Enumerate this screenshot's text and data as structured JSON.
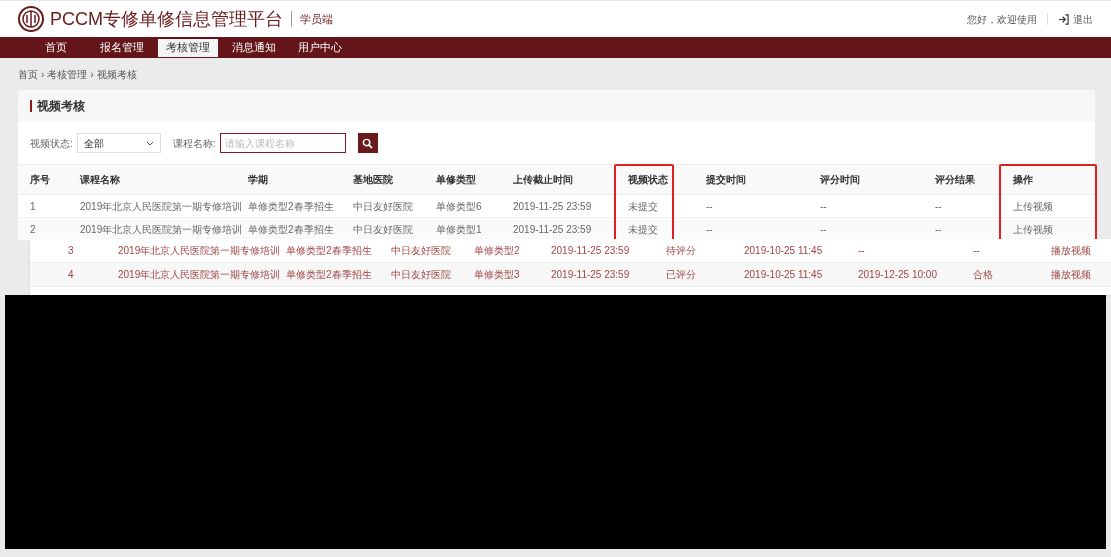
{
  "header": {
    "title": "PCCM专修单修信息管理平台",
    "subtitle": "学员端",
    "greeting": "您好，欢迎使用",
    "logout": "退出"
  },
  "nav": [
    {
      "label": "首页",
      "selected": false
    },
    {
      "label": "报名管理",
      "selected": false
    },
    {
      "label": "考核管理",
      "selected": true
    },
    {
      "label": "消息通知",
      "selected": false
    },
    {
      "label": "用户中心",
      "selected": false
    }
  ],
  "breadcrumb": {
    "separator": "›",
    "items": [
      "首页",
      "考核管理",
      "视频考核"
    ]
  },
  "panel_title": "视频考核",
  "filters": {
    "status_label": "视频状态:",
    "status_value": "全部",
    "name_label": "课程名称:",
    "name_placeholder": "请输入课程名称"
  },
  "table": {
    "columns": [
      {
        "label": "序号",
        "highlighted": false
      },
      {
        "label": "课程名称",
        "highlighted": false
      },
      {
        "label": "学期",
        "highlighted": false
      },
      {
        "label": "基地医院",
        "highlighted": false
      },
      {
        "label": "单修类型",
        "highlighted": false
      },
      {
        "label": "上传截止时间",
        "highlighted": false
      },
      {
        "label": "视频状态",
        "highlighted": true
      },
      {
        "label": "提交时间",
        "highlighted": false
      },
      {
        "label": "评分时间",
        "highlighted": false
      },
      {
        "label": "评分结果",
        "highlighted": false
      },
      {
        "label": "操作",
        "highlighted": true
      }
    ],
    "rows": [
      [
        "1",
        "2019年北京人民医院第一期专修培训",
        "单修类型2春季招生",
        "中日友好医院",
        "单修类型6",
        "2019-11-25 23:59",
        "未提交",
        "--",
        "--",
        "--",
        "上传视频"
      ],
      [
        "2",
        "2019年北京人民医院第一期专修培训",
        "单修类型2春季招生",
        "中日友好医院",
        "单修类型1",
        "2019-11-25 23:59",
        "未提交",
        "--",
        "--",
        "--",
        "上传视频"
      ]
    ]
  },
  "overlay_rows": [
    [
      "3",
      "2019年北京人民医院第一期专修培训",
      "单修类型2春季招生",
      "中日友好医院",
      "单修类型2",
      "2019-11-25 23:59",
      "待评分",
      "2019-10-25 11:45",
      "--",
      "--",
      "播放视频"
    ],
    [
      "4",
      "2019年北京人民医院第一期专修培训",
      "单修类型2春季招生",
      "中日友好医院",
      "单修类型3",
      "2019-11-25 23:59",
      "已评分",
      "2019-10-25 11:45",
      "2019-12-25 10:00",
      "合格",
      "播放视频"
    ]
  ]
}
